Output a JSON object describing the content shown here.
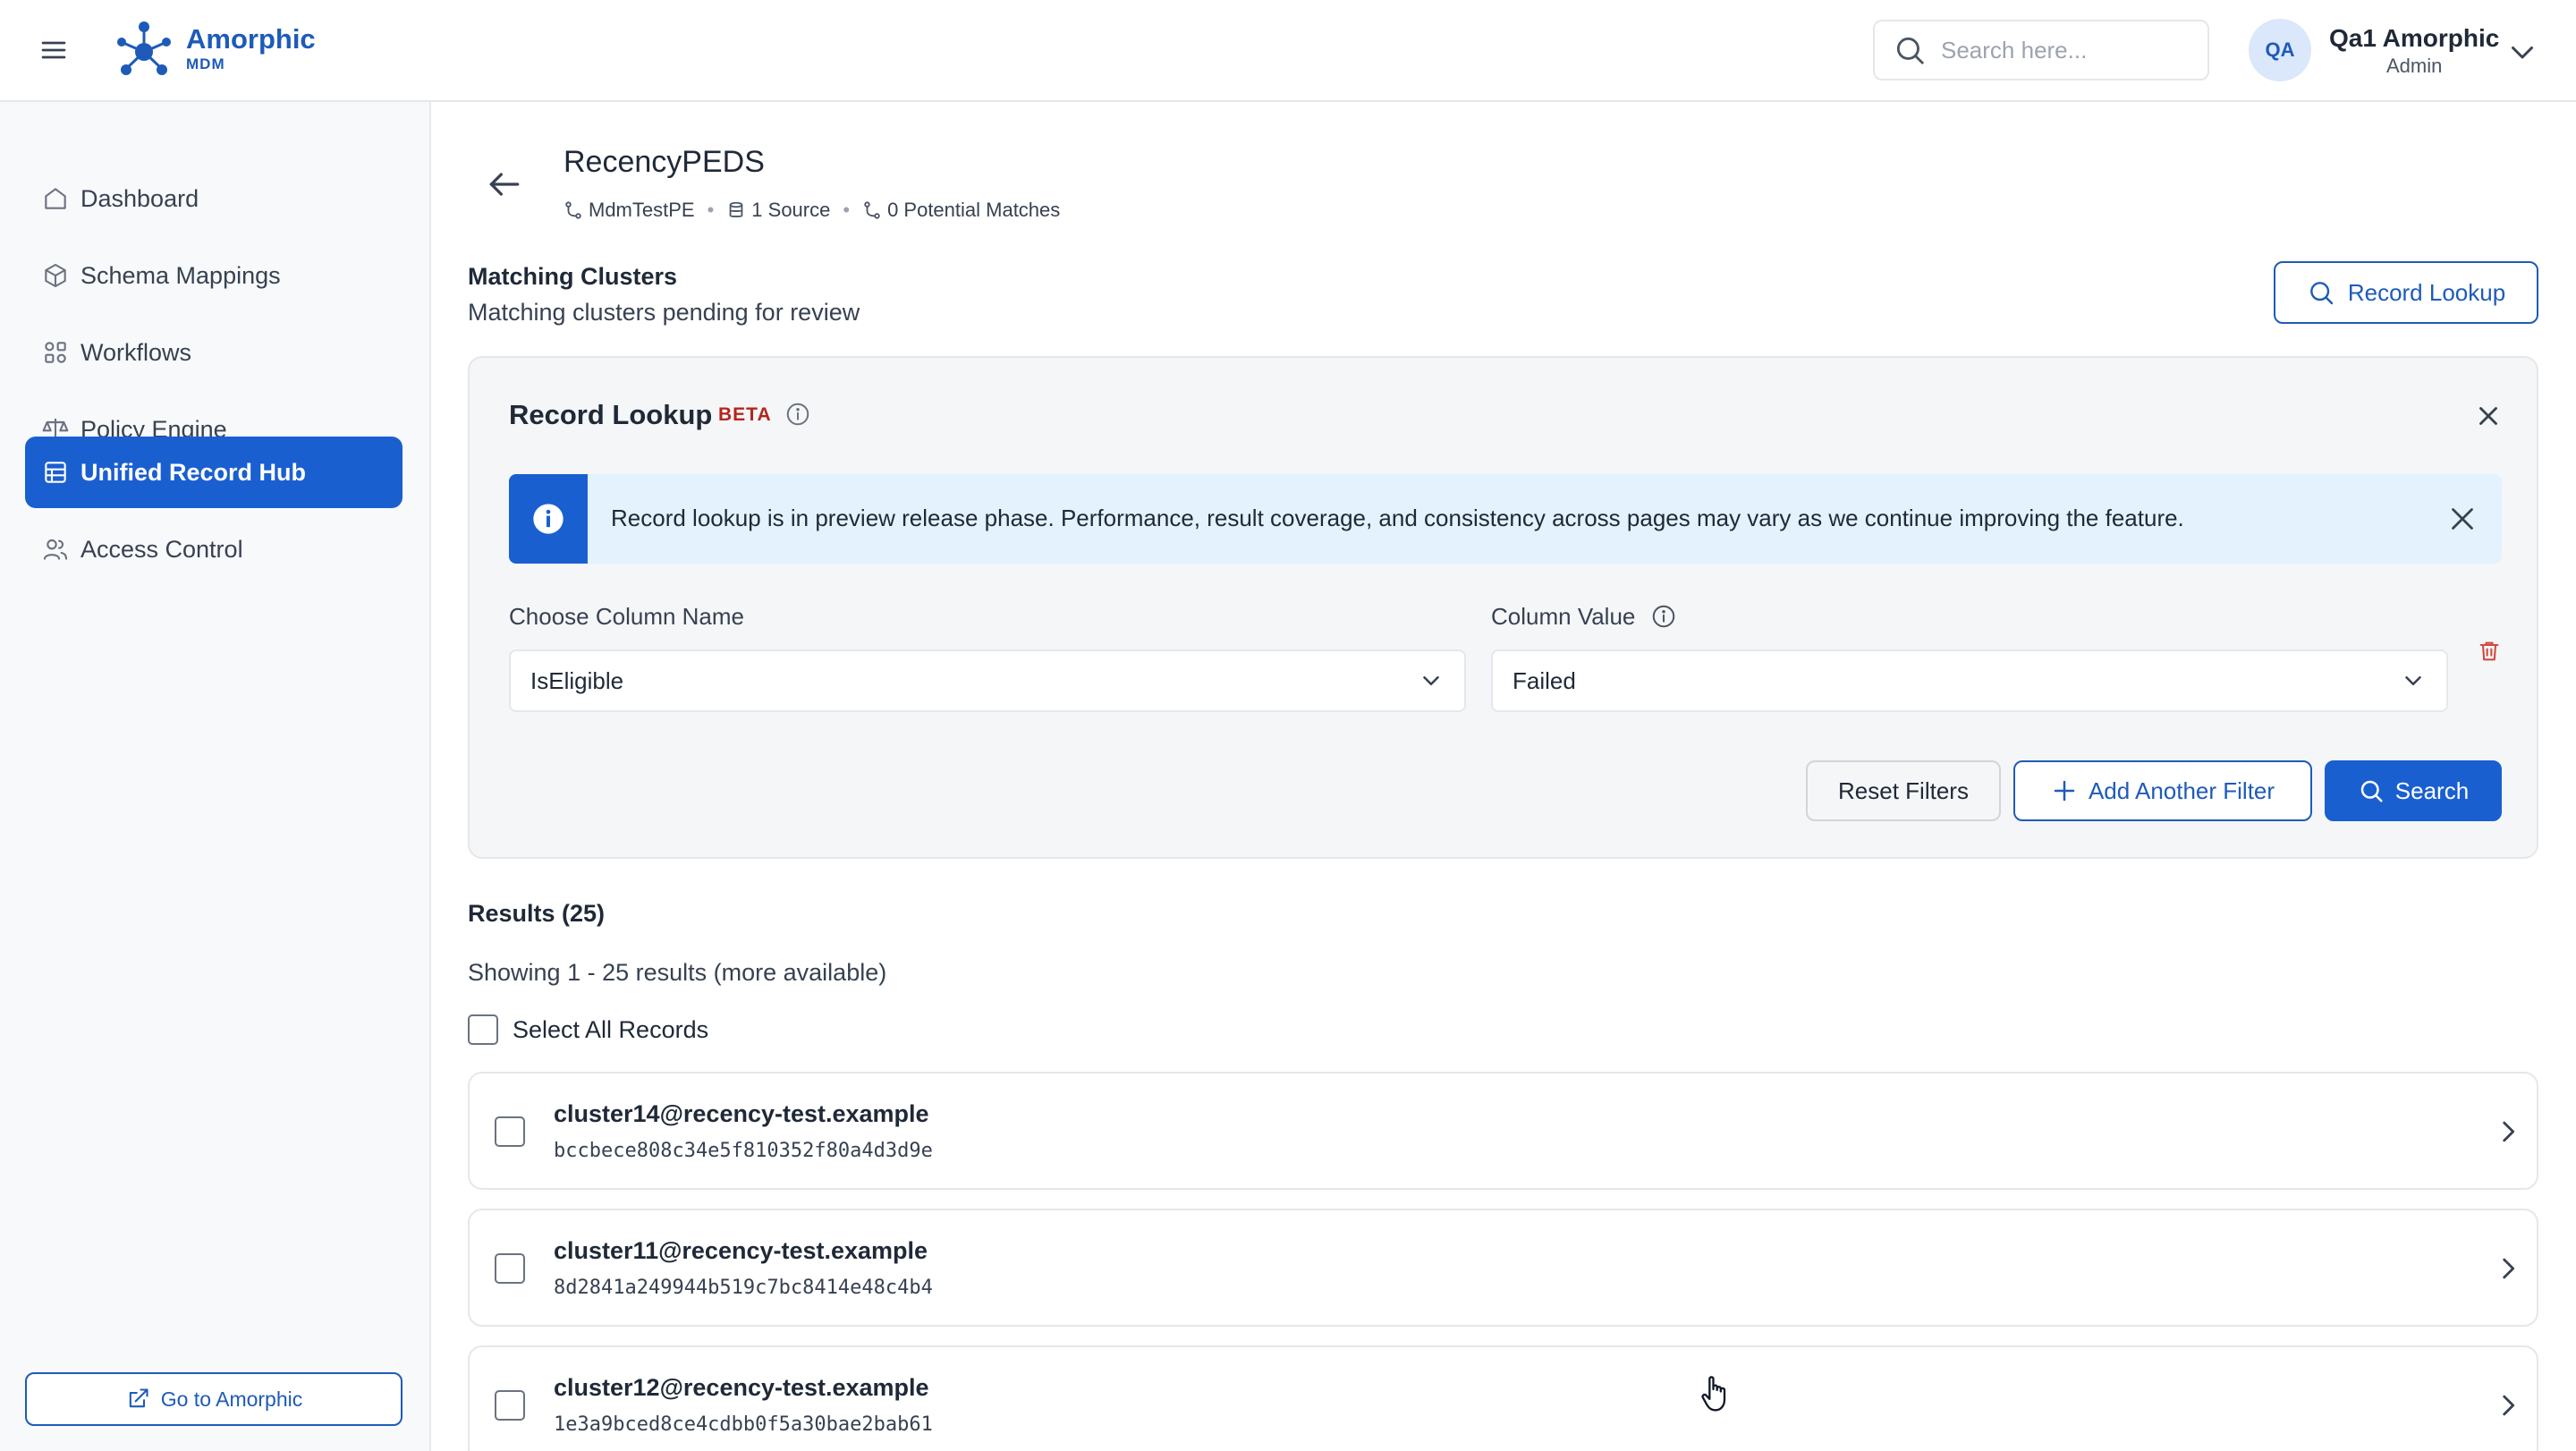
{
  "app": {
    "brand_name": "Amorphic",
    "brand_sub": "MDM"
  },
  "header": {
    "search_placeholder": "Search here...",
    "avatar_initials": "QA",
    "user_name": "Qa1 Amorphic",
    "user_role": "Admin"
  },
  "sidebar": {
    "items": [
      {
        "label": "Dashboard",
        "icon": "home-icon"
      },
      {
        "label": "Schema Mappings",
        "icon": "cube-icon"
      },
      {
        "label": "Workflows",
        "icon": "workflow-icon"
      },
      {
        "label": "Policy Engine",
        "icon": "scales-icon"
      },
      {
        "label": "Unified Record Hub",
        "icon": "database-icon",
        "active": true
      },
      {
        "label": "Access Control",
        "icon": "users-icon"
      }
    ],
    "footer_link": "Go to Amorphic"
  },
  "page": {
    "title": "RecencyPEDS",
    "meta": {
      "workflow": "MdmTestPE",
      "sources": "1 Source",
      "matches": "0 Potential Matches"
    },
    "section_title": "Matching Clusters",
    "section_subtitle": "Matching clusters pending for review",
    "record_lookup_button": "Record Lookup"
  },
  "lookup_panel": {
    "title": "Record Lookup",
    "badge": "BETA",
    "alert_text": "Record lookup is in preview release phase. Performance, result coverage, and consistency across pages may vary as we continue improving the feature.",
    "column_name_label": "Choose Column Name",
    "column_name_value": "IsEligible",
    "column_value_label": "Column Value",
    "column_value_value": "Failed",
    "reset_button": "Reset Filters",
    "add_filter_button": "Add Another Filter",
    "search_button": "Search"
  },
  "results": {
    "title": "Results (25)",
    "showing": "Showing 1 - 25 results (more available)",
    "select_all": "Select All Records",
    "items": [
      {
        "email": "cluster14@recency-test.example",
        "hash": "bccbece808c34e5f810352f80a4d3d9e"
      },
      {
        "email": "cluster11@recency-test.example",
        "hash": "8d2841a249944b519c7bc8414e48c4b4"
      },
      {
        "email": "cluster12@recency-test.example",
        "hash": "1e3a9bced8ce4cdbb0f5a30bae2bab61"
      }
    ]
  },
  "colors": {
    "primary": "#1a5fd0",
    "brand": "#1e5bb8",
    "beta": "#b3261e",
    "alert_bg": "#e3f2fd"
  }
}
